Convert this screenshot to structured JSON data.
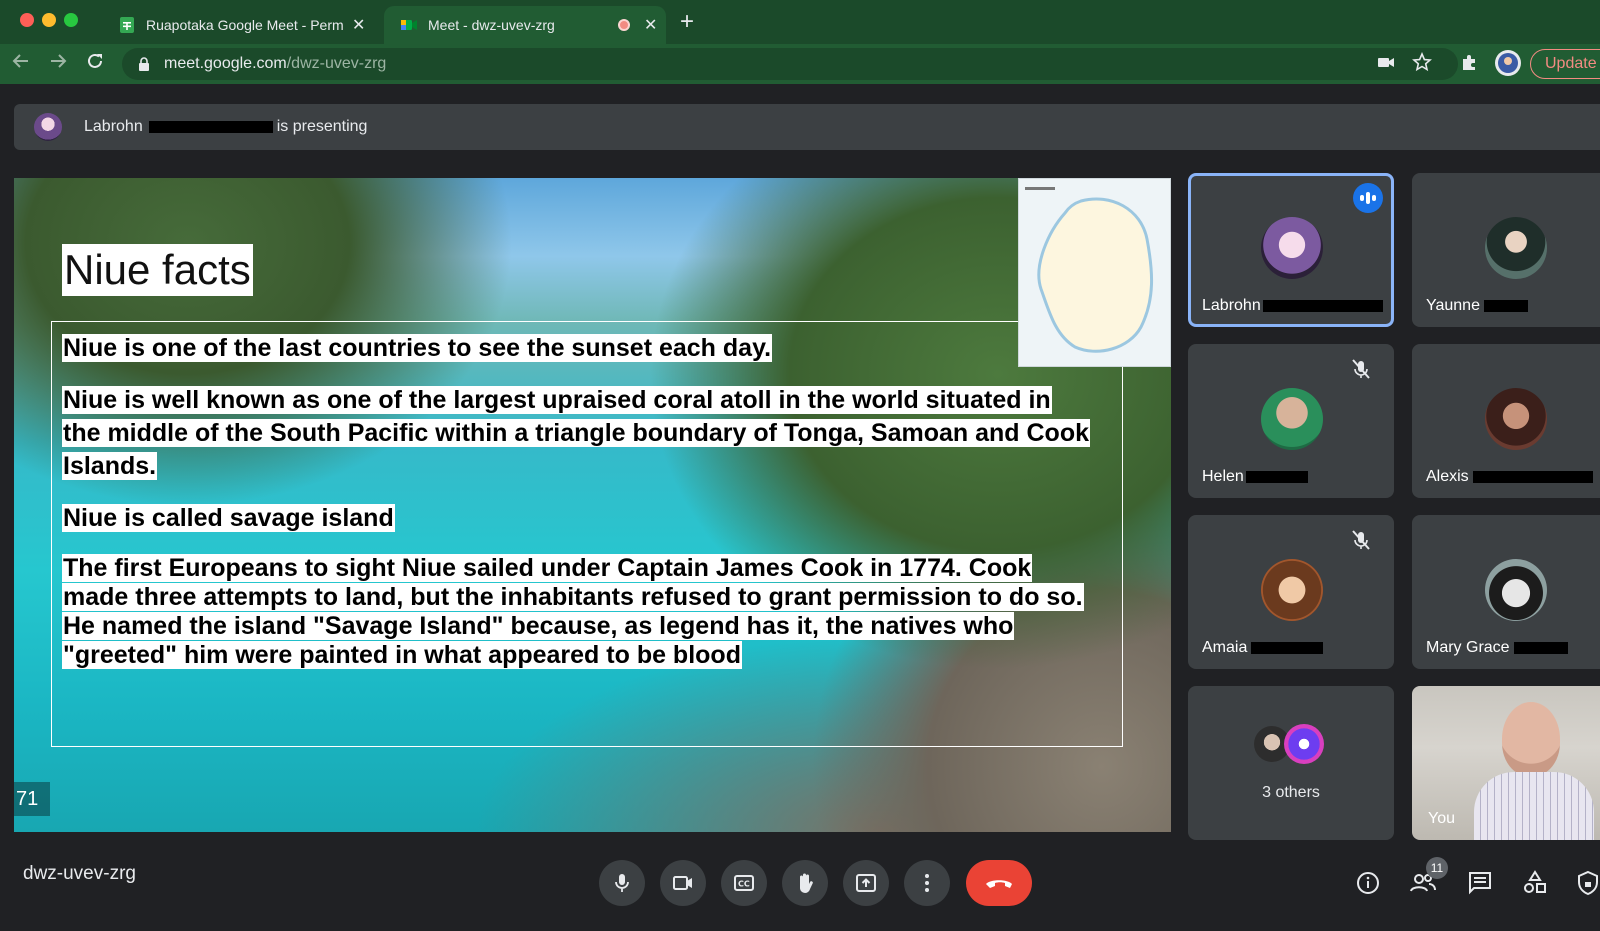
{
  "browser": {
    "tabs": [
      {
        "title": "Ruapotaka Google Meet - Perm",
        "close": "✕"
      },
      {
        "title": "Meet - dwz-uvev-zrg",
        "close": "✕"
      }
    ],
    "new_tab": "+",
    "url_host": "meet.google.com",
    "url_path": "/dwz-uvev-zrg",
    "update_label": "Update"
  },
  "meet": {
    "presenter_first": "Labrohn",
    "presenting_suffix": "is presenting",
    "slide": {
      "title": "Niue facts",
      "facts": [
        "Niue is one of the last countries to see the sunset each day.",
        "Niue is well known as one of the largest upraised coral atoll in the world situated in the middle of the South Pacific within a triangle boundary of Tonga, Samoan and Cook Islands.",
        "Niue is called savage island",
        "The first Europeans to sight Niue sailed under Captain James Cook in 1774. Cook made three attempts to land, but the inhabitants refused to grant permission to do so. He named the island \"Savage Island\" because, as legend has it, the natives who \"greeted\" him were painted in what appeared to be blood"
      ],
      "slide_number": "71"
    },
    "participants": [
      {
        "name": "Labrohn",
        "state": "speaking"
      },
      {
        "name": "Yaunne",
        "state": "muted"
      },
      {
        "name": "Helen",
        "state": "muted"
      },
      {
        "name": "Alexis",
        "state": "muted"
      },
      {
        "name": "Amaia",
        "state": "muted"
      },
      {
        "name": "Mary Grace",
        "state": "muted"
      }
    ],
    "others_label": "3 others",
    "self_label": "You",
    "meeting_code": "dwz-uvev-zrg",
    "people_count": "11"
  },
  "colors": {
    "chrome_green": "#1b4a2a",
    "active_tab": "#215c33",
    "meet_bg": "#202124",
    "end_call": "#ea4335",
    "speaking_blue": "#1a73e8"
  }
}
